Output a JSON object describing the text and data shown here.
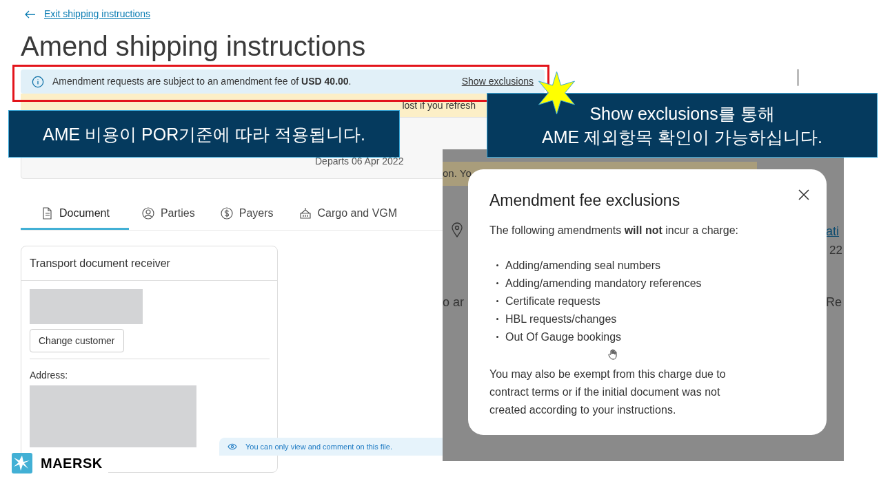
{
  "back_link": {
    "label": "Exit shipping instructions"
  },
  "title": "Amend shipping instructions",
  "fee_notice": {
    "text": "Amendment requests are subject to an amendment fee of **USD 40.00**.",
    "link": "Show exclusions"
  },
  "warning_notice": {
    "text": "lost if you refresh"
  },
  "shipment": {
    "departure": "Departs 06 Apr 2022"
  },
  "tabs": [
    {
      "label": "Document",
      "selected": true
    },
    {
      "label": "Parties",
      "selected": false
    },
    {
      "label": "Payers",
      "selected": false
    },
    {
      "label": "Cargo and VGM",
      "selected": false
    }
  ],
  "receiver_card": {
    "title": "Transport document receiver",
    "button": "Change customer",
    "address_label": "Address:"
  },
  "view_notice": "You can only view and comment on this file.",
  "footer": {
    "brand": "MAERSK"
  },
  "inset": {
    "banner_fragment": "on. Yo",
    "link_fragment": "ati",
    "date_fragment": "22",
    "row_fragments": [
      "o ar",
      "Re"
    ],
    "modal": {
      "title": "Amendment fee exclusions",
      "intro": "The following amendments **will not** incur a charge:",
      "items": [
        "Adding/amending seal numbers",
        "Adding/amending mandatory references",
        "Certificate requests",
        "HBL requests/changes",
        "Out Of Gauge bookings"
      ],
      "note": "You may also be exempt from this charge due to contract terms or if the initial document was not created according to your instructions."
    }
  },
  "callouts": [
    {
      "lines": [
        "AME 비용이 POR기준에 따라 적용됩니다."
      ]
    },
    {
      "lines": [
        "Show exclusions를 통해",
        "AME 제외항목 확인이 가능하십니다."
      ]
    }
  ]
}
